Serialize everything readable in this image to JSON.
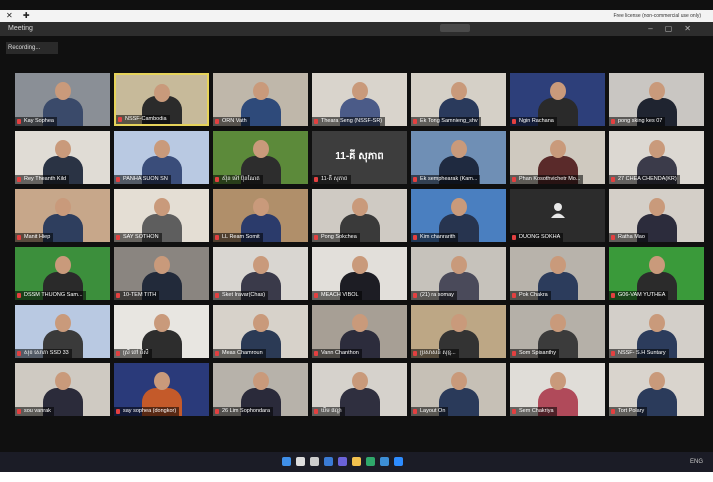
{
  "top_bar": {
    "notice": "Free license (non-commercial use only)"
  },
  "window": {
    "title": "Meeting"
  },
  "recording": {
    "label": "Recording..."
  },
  "participants": [
    {
      "name": "Kay Sophea",
      "wall": "#8a8f96",
      "shirt": "#3a4a6a"
    },
    {
      "name": "NSSF-Cambodia",
      "wall": "#c7ba9a",
      "shirt": "#2b2b2b",
      "active": true
    },
    {
      "name": "ORN Vath",
      "wall": "#bfb7aa",
      "shirt": "#2e4a7a"
    },
    {
      "name": "Theara Seng (NSSF-SR)",
      "wall": "#d9d4cc",
      "shirt": "#4b5b88"
    },
    {
      "name": "Ek Tong Samnieng_shv",
      "wall": "#d5d0c7",
      "shirt": "#2a3a5c"
    },
    {
      "name": "Ngin Rachana",
      "wall": "#2d3f7a",
      "shirt": "#2a2a2a"
    },
    {
      "name": "pong sking kes 07",
      "wall": "#c9c6c2",
      "shirt": "#1f2430"
    },
    {
      "name": "Rey Theanth Kild",
      "wall": "#e0dcd5",
      "shirt": "#2a3344"
    },
    {
      "name": "PANHA SUON SN",
      "wall": "#b9c9e2",
      "shirt": "#3a4d7a"
    },
    {
      "name": "ស៊ុន ម៉ៅ ប៊ុនណែត",
      "wall": "#5c8a3a",
      "shirt": "#2d2d2d"
    },
    {
      "name": "11-គី សុភាព",
      "wall": "#3d3d3d",
      "shirt": "#3d3d3d",
      "text_only": "11-គី សុភាព"
    },
    {
      "name": "Ek semphearak (Kam...",
      "wall": "#6f8fb5",
      "shirt": "#1f2a40"
    },
    {
      "name": "Phan Kosothvichetr Mo...",
      "wall": "#cfc9bf",
      "shirt": "#5a2a2a"
    },
    {
      "name": "27 CHEA CHENDA(KR)",
      "wall": "#dcd8d2",
      "shirt": "#3b3b4a"
    },
    {
      "name": "Manit Hiep",
      "wall": "#c7a78a",
      "shirt": "#2e3e5e"
    },
    {
      "name": "SAY SOTHON",
      "wall": "#e4ded4",
      "shirt": "#5e5e5e"
    },
    {
      "name": "LL Ream Somit",
      "wall": "#b08f6a",
      "shirt": "#2b3b6b"
    },
    {
      "name": "Pong Sokchea",
      "wall": "#cfcac3",
      "shirt": "#3a3a3a"
    },
    {
      "name": "Kim chanrarith",
      "wall": "#4a7fc0",
      "shirt": "#27344f"
    },
    {
      "name": "DUONG SOKHA",
      "wall": "#2c2c2c",
      "shirt": "#2c2c2c",
      "avatar": true
    },
    {
      "name": "Ratha Mao",
      "wall": "#d4cfc8",
      "shirt": "#2c2c3c"
    },
    {
      "name": "DSSM THUONG Sam...",
      "wall": "#3c8f3c",
      "shirt": "#2a2a2a"
    },
    {
      "name": "10-TEM TITH",
      "wall": "#8a8580",
      "shirt": "#222a3a"
    },
    {
      "name": "Sket Iravar(Chas)",
      "wall": "#d9d6d1",
      "shirt": "#3a3a4a"
    },
    {
      "name": "MEACH VIBOL",
      "wall": "#e2dfda",
      "shirt": "#1d1d24"
    },
    {
      "name": "(21) ra somay",
      "wall": "#c6c2bb",
      "shirt": "#4a4a5a"
    },
    {
      "name": "Pok Chakra",
      "wall": "#b8b3ab",
      "shirt": "#2c3c5c"
    },
    {
      "name": "G06-VAM YUTHEA",
      "wall": "#3a9a3a",
      "shirt": "#2b2b2b"
    },
    {
      "name": "សុខ សោភា SSD 33",
      "wall": "#b9c9e2",
      "shirt": "#3a3a3a"
    },
    {
      "name": "ស្រី ពៅ ពិសី",
      "wall": "#e8e6e1",
      "shirt": "#2d2d2d"
    },
    {
      "name": "Meas Chamroun",
      "wall": "#d7d2ca",
      "shirt": "#2b3a55"
    },
    {
      "name": "Vann Chanthon",
      "wall": "#a79f95",
      "shirt": "#2c2c3c"
    },
    {
      "name": "ប្រសាសន៍ សុខ្ម...",
      "wall": "#bda785",
      "shirt": "#333"
    },
    {
      "name": "Som Spisanthy",
      "wall": "#b5b0a8",
      "shirt": "#3b3b3b"
    },
    {
      "name": "NSSF- S.H Suntary",
      "wall": "#d3cfc9",
      "shirt": "#2c3c5c"
    },
    {
      "name": "sou vanrak",
      "wall": "#cfcac2",
      "shirt": "#2b2b3a"
    },
    {
      "name": "say sophea (dongkor)",
      "wall": "#2a3a7a",
      "shirt": "#c45a2a"
    },
    {
      "name": "26 Lim Sophondara",
      "wall": "#b7b2aa",
      "shirt": "#2a2a3a"
    },
    {
      "name": "ឃឹម ផល្លា",
      "wall": "#d6d2cc",
      "shirt": "#2f2f3f"
    },
    {
      "name": "Layout On",
      "wall": "#c6c0b6",
      "shirt": "#2a3a5a"
    },
    {
      "name": "Sem Chakriya",
      "wall": "#e0ddd8",
      "shirt": "#b04a5a"
    },
    {
      "name": "Tort Polary",
      "wall": "#d9d4cd",
      "shirt": "#2b3b5b"
    }
  ],
  "taskbar": {
    "tray": "ENG"
  },
  "colors": {
    "active_border": "#e6d35a",
    "muted_mic": "#e34040",
    "taskbar_bg": "#1b1c26"
  },
  "taskbar_apps": [
    "windows-start",
    "search",
    "task-view",
    "widgets",
    "teams-chat",
    "file-explorer",
    "edge",
    "store",
    "zoom"
  ]
}
